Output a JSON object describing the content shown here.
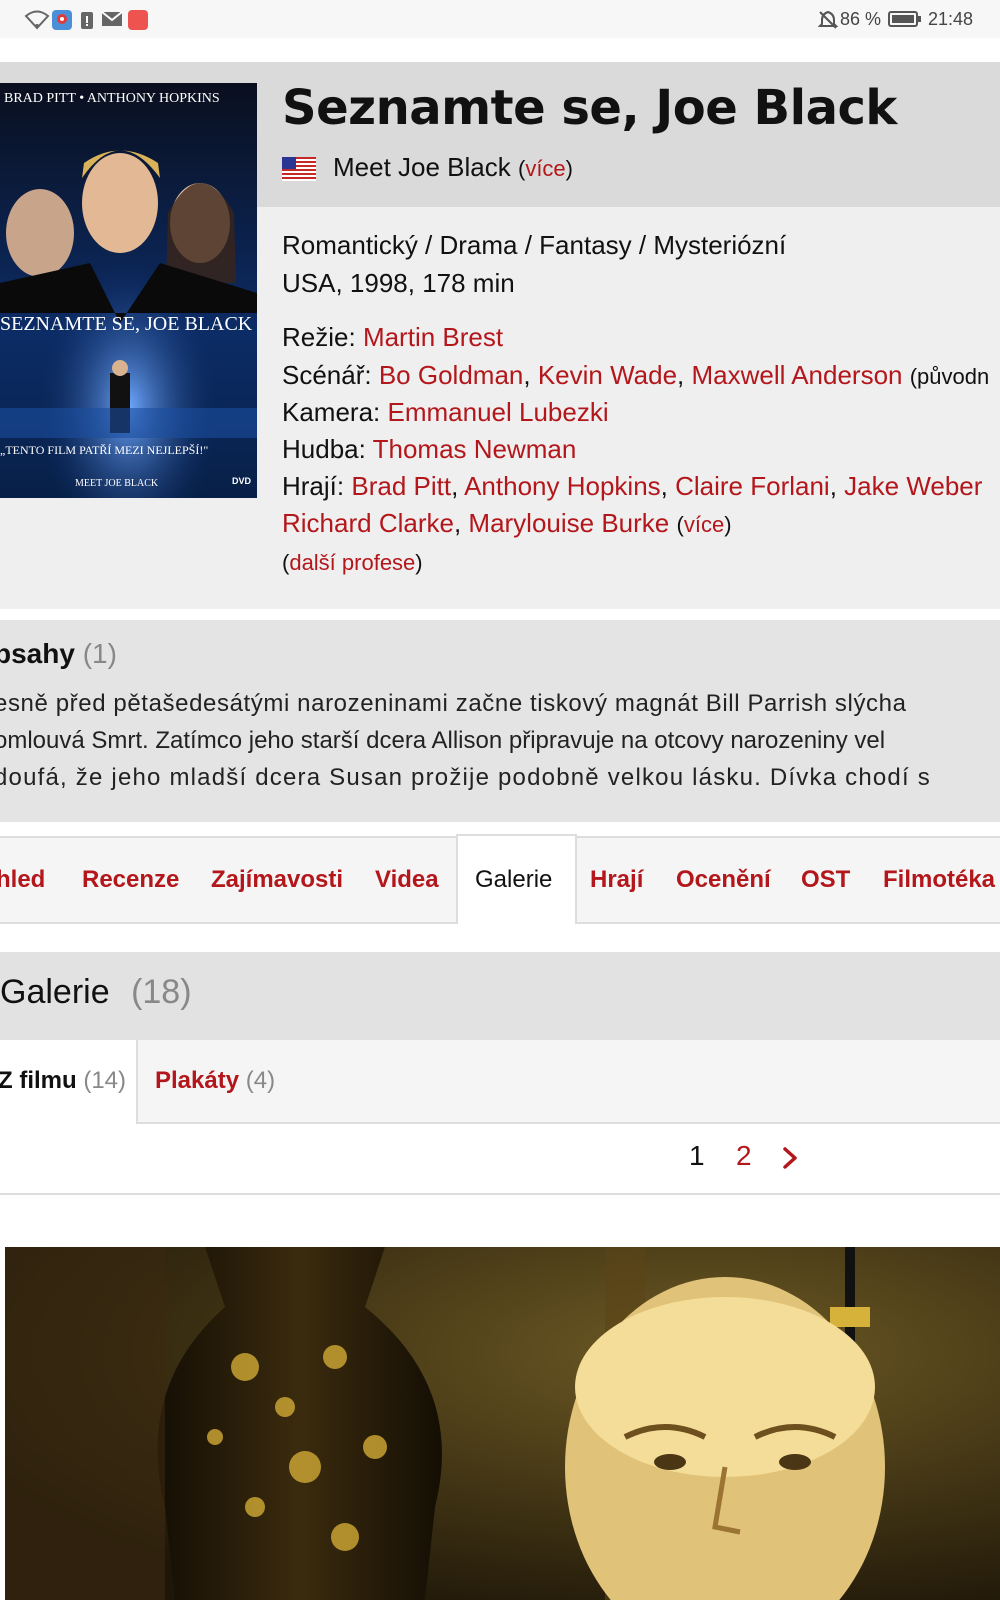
{
  "status_bar": {
    "battery": "86 %",
    "time": "21:48"
  },
  "movie": {
    "title": "Seznamte se, Joe Black",
    "original_title": "Meet Joe Black",
    "more_label": "více",
    "genres": "Romantický / Drama / Fantasy / Mysteriózní",
    "meta": "USA, 1998, 178 min",
    "director_label": "Režie:",
    "director": "Martin Brest",
    "writers_label": "Scénář:",
    "writers": [
      "Bo Goldman",
      "Kevin Wade",
      "Maxwell Anderson"
    ],
    "writers_note": "(původn",
    "camera_label": "Kamera:",
    "camera": "Emmanuel Lubezki",
    "music_label": "Hudba:",
    "music": "Thomas Newman",
    "cast_label": "Hrají:",
    "cast": [
      "Brad Pitt",
      "Anthony Hopkins",
      "Claire Forlani",
      "Jake Weber",
      "Richard Clarke",
      "Marylouise Burke"
    ],
    "more_cast": "více",
    "other_professions": "další profese"
  },
  "poster": {
    "top_text": "BRAD PITT • ANTHONY HOPKINS",
    "title_text": "SEZNAMTE SE, JOE BLACK",
    "quote": "„TENTO FILM PATŘÍ MEZI NEJLEPŠÍ!\"",
    "bottom_text": "MEET JOE BLACK",
    "dvd": "DVD"
  },
  "plot": {
    "title": "bsahy",
    "count": "(1)",
    "lines": [
      "esně před pětašedesátými narozeninami začne tiskový magnát Bill Parrish slýcha",
      "omlouvá Smrt. Zatímco jeho starší dcera Allison připravuje na otcovy narozeniny vel",
      "doufá, že jeho mladší dcera Susan prožije podobně velkou lásku. Dívka chodí s"
    ]
  },
  "tabs": [
    {
      "label": "hled",
      "active": false
    },
    {
      "label": "Recenze",
      "active": false
    },
    {
      "label": "Zajímavosti",
      "active": false
    },
    {
      "label": "Videa",
      "active": false
    },
    {
      "label": "Galerie",
      "active": true
    },
    {
      "label": "Hrají",
      "active": false
    },
    {
      "label": "Ocenění",
      "active": false
    },
    {
      "label": "OST",
      "active": false
    },
    {
      "label": "Filmotéka",
      "active": false
    }
  ],
  "gallery": {
    "title": "Galerie",
    "count": "(18)",
    "subtabs": [
      {
        "label": "Z filmu",
        "count": "(14)",
        "active": true
      },
      {
        "label": "Plakáty",
        "count": "(4)",
        "active": false
      }
    ],
    "pages": [
      "1",
      "2"
    ],
    "current_page": "1"
  },
  "colors": {
    "link": "#b3171b",
    "header_bg": "#dadada",
    "info_bg": "#efefef"
  }
}
